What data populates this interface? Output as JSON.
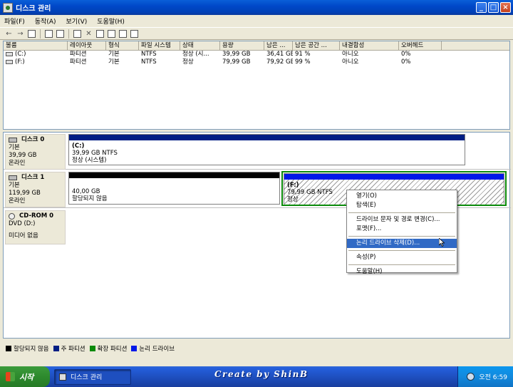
{
  "window": {
    "title": "디스크 관리",
    "buttons": [
      "_",
      "□",
      "×"
    ]
  },
  "menu": [
    "파일(F)",
    "동작(A)",
    "보기(V)",
    "도움말(H)"
  ],
  "volumes": {
    "columns": [
      "볼륨",
      "레이아웃",
      "형식",
      "파일 시스템",
      "상태",
      "용량",
      "남은 ...",
      "남은 공간 ...",
      "내결함성",
      "오버헤드"
    ],
    "rows": [
      [
        "(C:)",
        "파티션",
        "기본",
        "NTFS",
        "정상 (시...",
        "39,99 GB",
        "36,41 GB",
        "91 %",
        "아니오",
        "0%"
      ],
      [
        "(F:)",
        "파티션",
        "기본",
        "NTFS",
        "정상",
        "79,99 GB",
        "79,92 GB",
        "99 %",
        "아니오",
        "0%"
      ]
    ]
  },
  "disks": [
    {
      "name": "디스크 0",
      "type": "기본",
      "size": "39,99 GB",
      "status": "온라인"
    },
    {
      "name": "디스크 1",
      "type": "기본",
      "size": "119,99 GB",
      "status": "온라인"
    },
    {
      "name": "CD-ROM 0",
      "type": "DVD (D:)",
      "size": "",
      "status": "미디어 없음"
    }
  ],
  "partitions": {
    "c": {
      "label": "(C:)",
      "line1": "39,99 GB NTFS",
      "line2": "정상 (시스템)",
      "color": "#001e84"
    },
    "unalloc": {
      "line1": "40,00 GB",
      "line2": "할당되지 않음",
      "color": "#000000"
    },
    "f": {
      "label": "(F:)",
      "line1": "79,99 GB NTFS",
      "line2": "정상",
      "color": "#0018e8",
      "extended_color": "#0a8a0a"
    }
  },
  "context_menu": {
    "items": [
      "열기(O)",
      "탐색(E)",
      "드라이브 문자 및 경로 변경(C)...",
      "포맷(F)...",
      "논리 드라이브 삭제(D)...",
      "속성(P)",
      "도움말(H)"
    ],
    "highlighted": "논리 드라이브 삭제(D)..."
  },
  "legend": [
    {
      "label": "할당되지 않음",
      "color": "#000000"
    },
    {
      "label": "주 파티션",
      "color": "#001e84"
    },
    {
      "label": "확장 파티션",
      "color": "#0a8a0a"
    },
    {
      "label": "논리 드라이브",
      "color": "#0018e8"
    }
  ],
  "taskbar": {
    "start": "시작",
    "task": "디스크 관리",
    "banner": "Create by ShinB",
    "clock": "오전 6:59"
  }
}
